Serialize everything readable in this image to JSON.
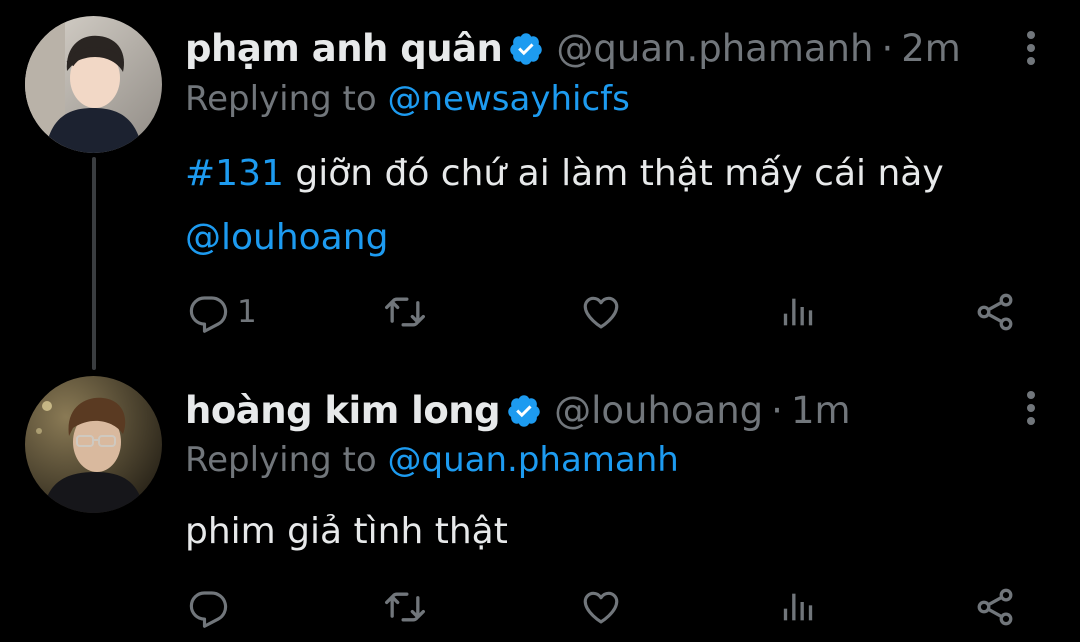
{
  "tweets": [
    {
      "name": "phạm anh quân",
      "handle": "@quan.phamanh",
      "separator": "·",
      "time": "2m",
      "replying_prefix": "Replying to",
      "replying_to": "@newsayhicfs",
      "body": {
        "hashtag": "#131",
        "text": "giỡn đó chứ ai làm thật mấy cái này",
        "mention": "@louhoang"
      },
      "reply_count": "1",
      "verified": true
    },
    {
      "name": "hoàng kim long",
      "handle": "@louhoang",
      "separator": "·",
      "time": "1m",
      "replying_prefix": "Replying to",
      "replying_to": "@quan.phamanh",
      "body": {
        "text": "phim giả tình thật"
      },
      "reply_count": "",
      "verified": true
    }
  ],
  "icons": {
    "more": "more-vertical-icon",
    "reply": "reply-icon",
    "retweet": "retweet-icon",
    "like": "heart-icon",
    "views": "views-icon",
    "share": "share-icon",
    "verified": "verified-badge-icon"
  },
  "colors": {
    "background": "#000000",
    "text": "#e7e9ea",
    "muted": "#71767b",
    "accent": "#1d9bf0",
    "thread_line": "#3a3d40"
  }
}
